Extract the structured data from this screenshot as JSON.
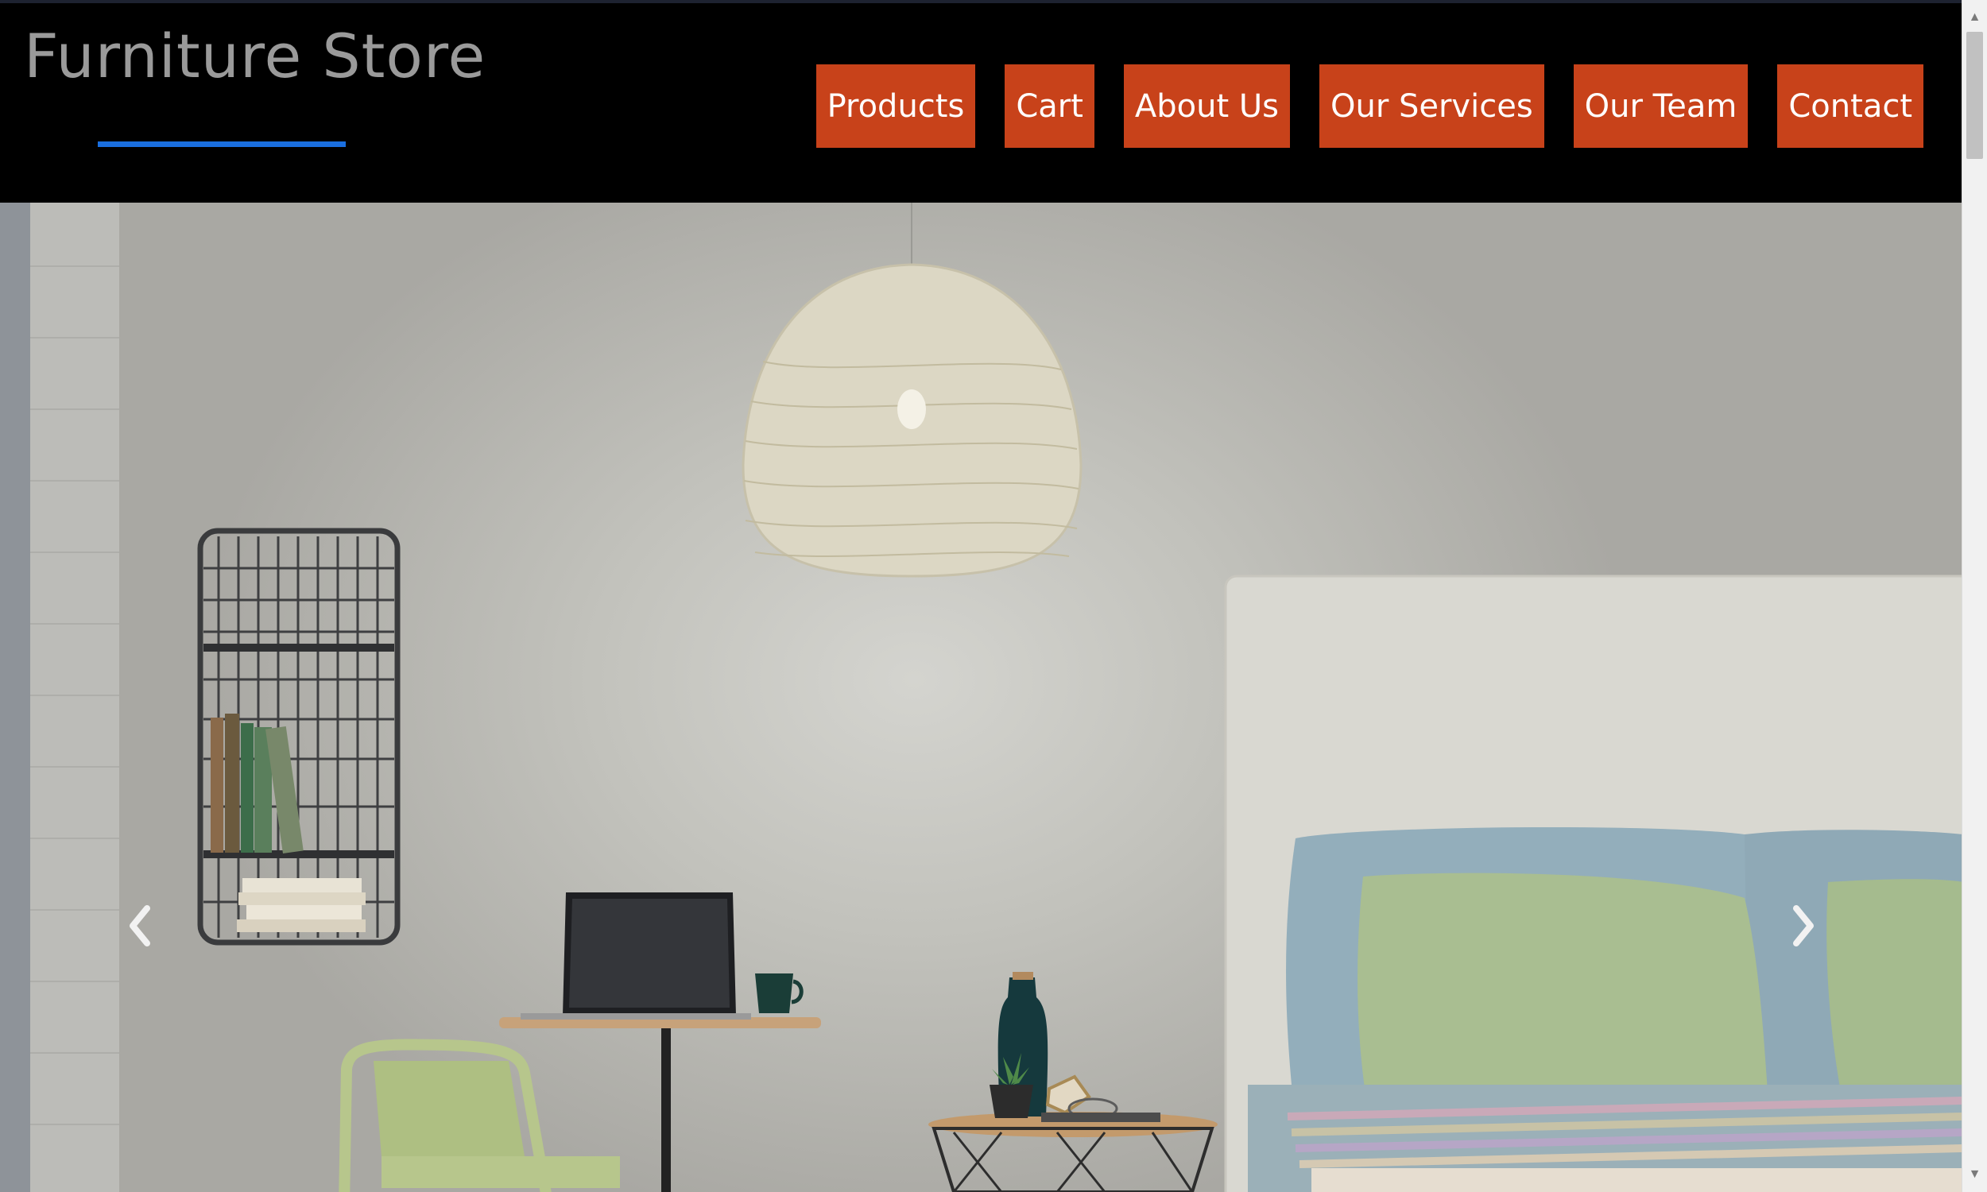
{
  "header": {
    "brand": "Furniture Store",
    "nav": [
      {
        "label": "Products"
      },
      {
        "label": "Cart"
      },
      {
        "label": "About Us"
      },
      {
        "label": "Our Services"
      },
      {
        "label": "Our Team"
      },
      {
        "label": "Contact"
      }
    ]
  },
  "hero": {
    "prev_icon": "chevron-left-icon",
    "next_icon": "chevron-right-icon"
  },
  "colors": {
    "nav_button": "#c8421a",
    "brand_text": "#9a9a9a",
    "underline": "#1a6fe0",
    "header_bg": "#000000"
  }
}
